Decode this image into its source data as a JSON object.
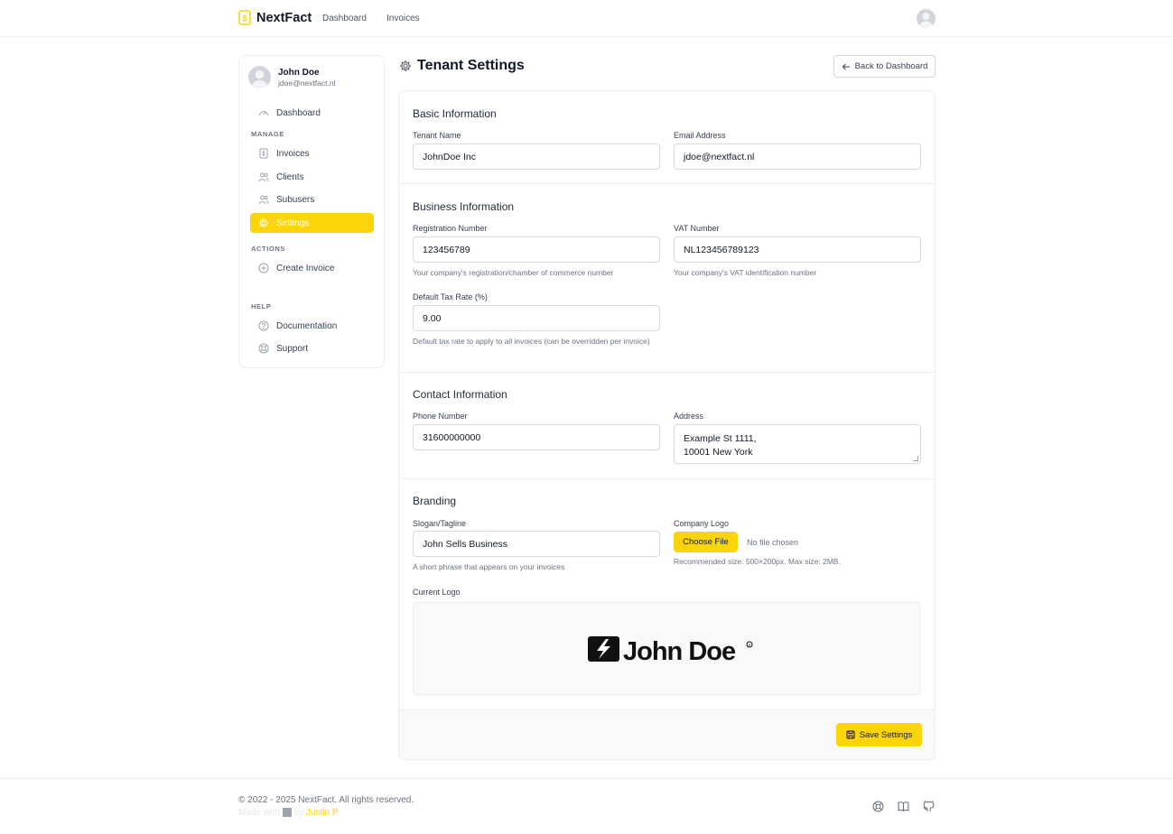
{
  "brand": {
    "name": "NextFact",
    "accent": "#fbd40a"
  },
  "topnav": {
    "links": [
      "Dashboard",
      "Invoices"
    ]
  },
  "user": {
    "name": "John Doe",
    "email": "jdoe@nextfact.nl"
  },
  "sidebar": {
    "dashboard": "Dashboard",
    "manage_heading": "MANAGE",
    "manage": [
      "Invoices",
      "Clients",
      "Subusers",
      "Settings"
    ],
    "actions_heading": "ACTIONS",
    "actions": [
      "Create Invoice"
    ],
    "help_heading": "HELP",
    "help": [
      "Documentation",
      "Support"
    ],
    "active": "Settings"
  },
  "page": {
    "title": "Tenant Settings",
    "back_label": "Back to Dashboard"
  },
  "basic": {
    "title": "Basic Information",
    "tenant_name_label": "Tenant Name",
    "tenant_name": "JohnDoe Inc",
    "email_label": "Email Address",
    "email": "jdoe@nextfact.nl"
  },
  "business": {
    "title": "Business Information",
    "reg_label": "Registration Number",
    "reg": "123456789",
    "reg_help": "Your company's registration/chamber of commerce number",
    "vat_label": "VAT Number",
    "vat": "NL123456789123",
    "vat_help": "Your company's VAT identification number",
    "tax_label": "Default Tax Rate (%)",
    "tax": "9.00",
    "tax_help": "Default tax rate to apply to all invoices (can be overridden per invoice)"
  },
  "contact": {
    "title": "Contact Information",
    "phone_label": "Phone Number",
    "phone": "31600000000",
    "address_label": "Address",
    "address_line1": "Example St 1111,",
    "address_line2": "10001 New York"
  },
  "branding": {
    "title": "Branding",
    "slogan_label": "Slogan/Tagline",
    "slogan": "John Sells Business",
    "slogan_help": "A short phrase that appears on your invoices",
    "logo_label": "Company Logo",
    "choose_file": "Choose File",
    "file_status": "No file chosen",
    "logo_help": "Recommended size: 500×200px. Max size: 2MB.",
    "current_logo_label": "Current Logo",
    "current_logo_text": "John Doe"
  },
  "save_label": "Save Settings",
  "footer": {
    "copyright": "© 2022 - 2025 NextFact. All rights reserved.",
    "made_with": "Made with",
    "by": "by",
    "author": "Justin P"
  }
}
